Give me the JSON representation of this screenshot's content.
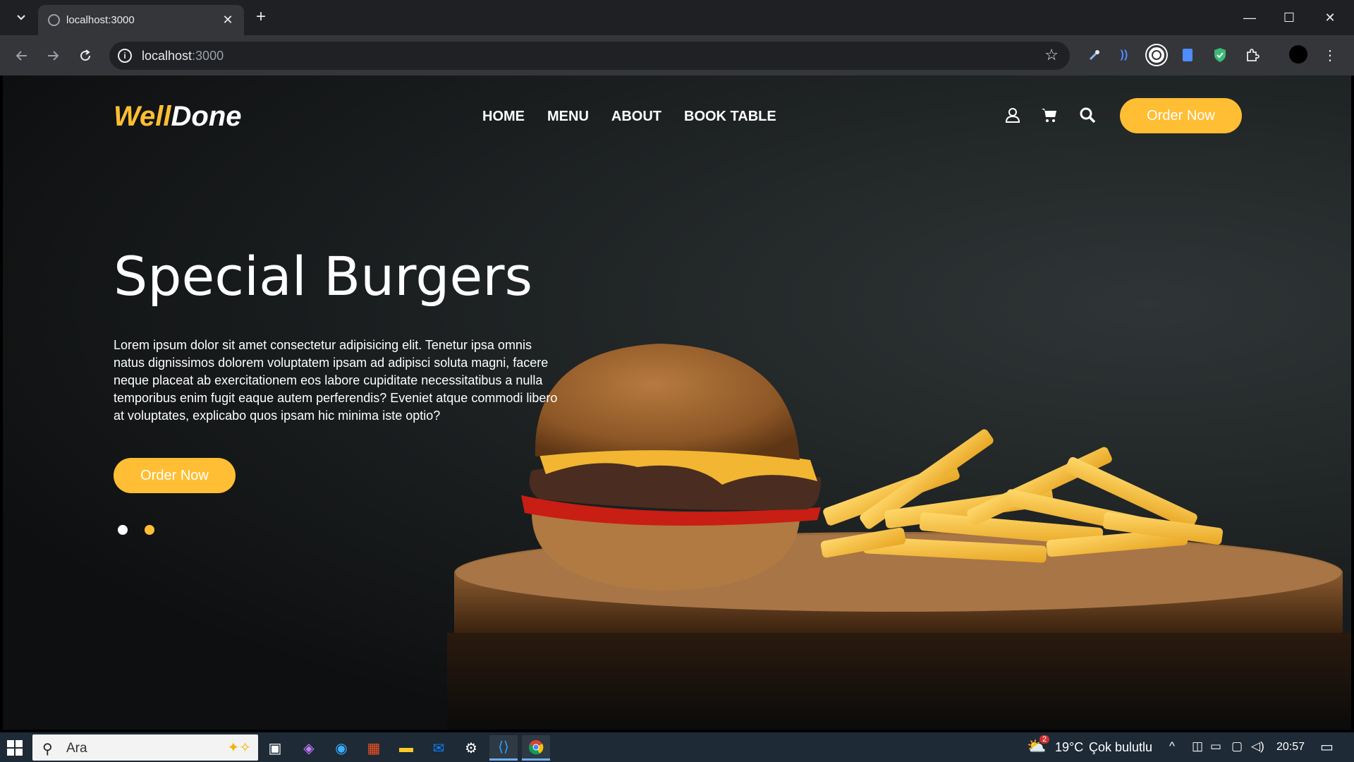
{
  "browser": {
    "tab_title": "localhost:3000",
    "new_tab_symbol": "+",
    "close_tab_symbol": "✕",
    "url_host": "localhost",
    "url_port": ":3000",
    "window_minimize": "—",
    "window_maximize": "☐",
    "window_close": "✕"
  },
  "site": {
    "logo_part1": "Well",
    "logo_part2": "Done",
    "nav": [
      "HOME",
      "MENU",
      "ABOUT",
      "BOOK TABLE"
    ],
    "header_cta": "Order Now",
    "hero_title": "Special Burgers",
    "hero_text": "Lorem ipsum dolor sit amet consectetur adipisicing elit. Tenetur ipsa omnis natus dignissimos dolorem voluptatem ipsam ad adipisci soluta magni, facere neque placeat ab exercitationem eos labore cupiditate necessitatibus a nulla temporibus enim fugit eaque autem perferendis? Eveniet atque commodi libero at voluptates, explicabo quos ipsam hic minima iste optio?",
    "hero_cta": "Order Now",
    "slides": [
      {
        "active": false,
        "color": "#ffffff"
      },
      {
        "active": true,
        "color": "#ffbe33"
      }
    ]
  },
  "taskbar": {
    "search_placeholder": "Ara",
    "weather_temp": "19°C",
    "weather_desc": "Çok bulutlu",
    "weather_badge": "2",
    "clock": "20:57"
  },
  "colors": {
    "accent": "#ffbe33",
    "page_bg": "#121314",
    "chrome_bg": "#35363a"
  },
  "icons": {
    "user": "user-icon",
    "cart": "cart-icon",
    "search": "search-icon"
  }
}
